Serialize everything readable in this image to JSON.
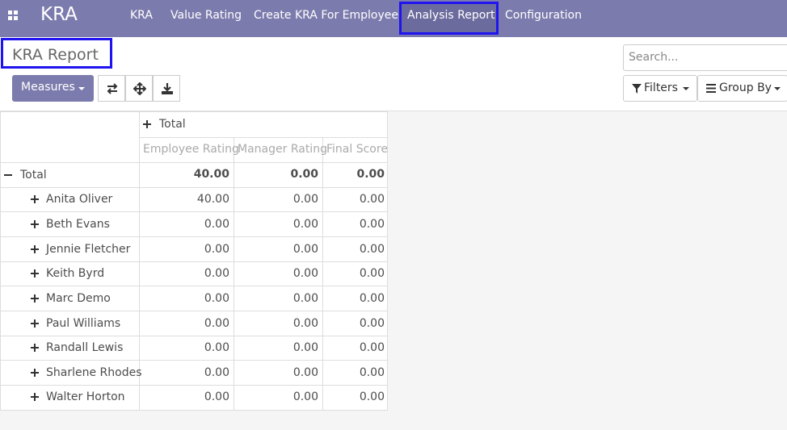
{
  "navbar": {
    "brand": "KRA",
    "items": [
      "KRA",
      "Value Rating",
      "Create KRA For Employee",
      "Analysis Report",
      "Configuration"
    ],
    "active": "Analysis Report"
  },
  "page_title": "KRA Report",
  "toolbar": {
    "measures_label": "Measures",
    "filters_label": "Filters",
    "group_by_label": "Group By"
  },
  "search": {
    "placeholder": "Search..."
  },
  "pivot": {
    "col_header": "Total",
    "measures": [
      "Employee Rating",
      "Manager Rating",
      "Final Score"
    ],
    "total_row": {
      "label": "Total",
      "values": [
        "40.00",
        "0.00",
        "0.00"
      ]
    },
    "rows": [
      {
        "label": "Anita Oliver",
        "values": [
          "40.00",
          "0.00",
          "0.00"
        ]
      },
      {
        "label": "Beth Evans",
        "values": [
          "0.00",
          "0.00",
          "0.00"
        ]
      },
      {
        "label": "Jennie Fletcher",
        "values": [
          "0.00",
          "0.00",
          "0.00"
        ]
      },
      {
        "label": "Keith Byrd",
        "values": [
          "0.00",
          "0.00",
          "0.00"
        ]
      },
      {
        "label": "Marc Demo",
        "values": [
          "0.00",
          "0.00",
          "0.00"
        ]
      },
      {
        "label": "Paul Williams",
        "values": [
          "0.00",
          "0.00",
          "0.00"
        ]
      },
      {
        "label": "Randall Lewis",
        "values": [
          "0.00",
          "0.00",
          "0.00"
        ]
      },
      {
        "label": "Sharlene Rhodes",
        "values": [
          "0.00",
          "0.00",
          "0.00"
        ]
      },
      {
        "label": "Walter Horton",
        "values": [
          "0.00",
          "0.00",
          "0.00"
        ]
      }
    ]
  },
  "colors": {
    "brand": "#7c7bad",
    "highlight_box": "#1f14f0"
  }
}
